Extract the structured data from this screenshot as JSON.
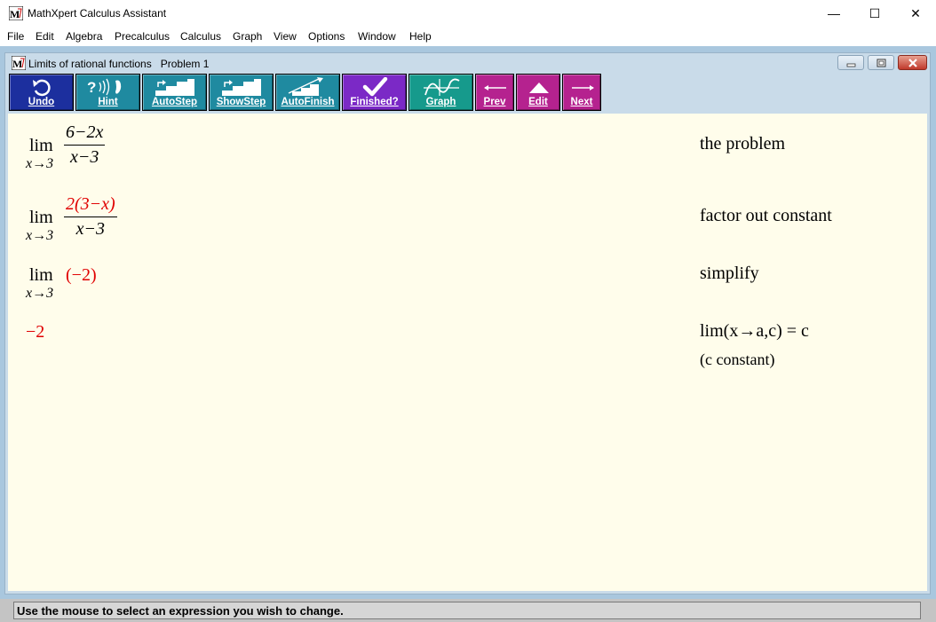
{
  "app": {
    "title": "MathXpert Calculus Assistant"
  },
  "window_controls": {
    "minimize": "—",
    "maximize": "☐",
    "close": "✕"
  },
  "menu": [
    "File",
    "Edit",
    "Algebra",
    "Precalculus",
    "Calculus",
    "Graph",
    "View",
    "Options",
    "Window",
    "Help"
  ],
  "child": {
    "topic": "Limits of rational functions",
    "problem": "Problem 1"
  },
  "toolbar": [
    {
      "label": "Undo",
      "icon": "undo-icon",
      "color": "#1c2f9e"
    },
    {
      "label": "Hint",
      "icon": "hint-icon",
      "color": "#1f8aa0"
    },
    {
      "label": "AutoStep",
      "icon": "autostep-icon",
      "color": "#1f8aa0"
    },
    {
      "label": "ShowStep",
      "icon": "showstep-icon",
      "color": "#1f8aa0"
    },
    {
      "label": "AutoFinish",
      "icon": "autofinish-icon",
      "color": "#1f8aa0"
    },
    {
      "label": "Finished?",
      "icon": "checkmark-icon",
      "color": "#7b29c6"
    },
    {
      "label": "Graph",
      "icon": "graph-icon",
      "color": "#169a8c"
    },
    {
      "label": "Prev",
      "icon": "arrow-left-icon",
      "color": "#b5228f"
    },
    {
      "label": "Edit",
      "icon": "triangle-up-icon",
      "color": "#b5228f"
    },
    {
      "label": "Next",
      "icon": "arrow-right-icon",
      "color": "#b5228f"
    }
  ],
  "steps": [
    {
      "lim": "lim",
      "sub": "x→3",
      "num": "6−2x",
      "den": "x−3",
      "justification": "the problem"
    },
    {
      "lim": "lim",
      "sub": "x→3",
      "num": "2(3−x)",
      "den": "x−3",
      "justification": "factor out constant"
    },
    {
      "lim": "lim",
      "sub": "x→3",
      "expr": "(−2)",
      "justification": "simplify"
    },
    {
      "result": "−2",
      "justification": "lim(x→a,c) = c",
      "justification2": "(c constant)"
    }
  ],
  "status": "Use the mouse to select an expression you wish to change.",
  "colors": {
    "workspace": "#fffdeb",
    "highlight": "#e00000"
  }
}
